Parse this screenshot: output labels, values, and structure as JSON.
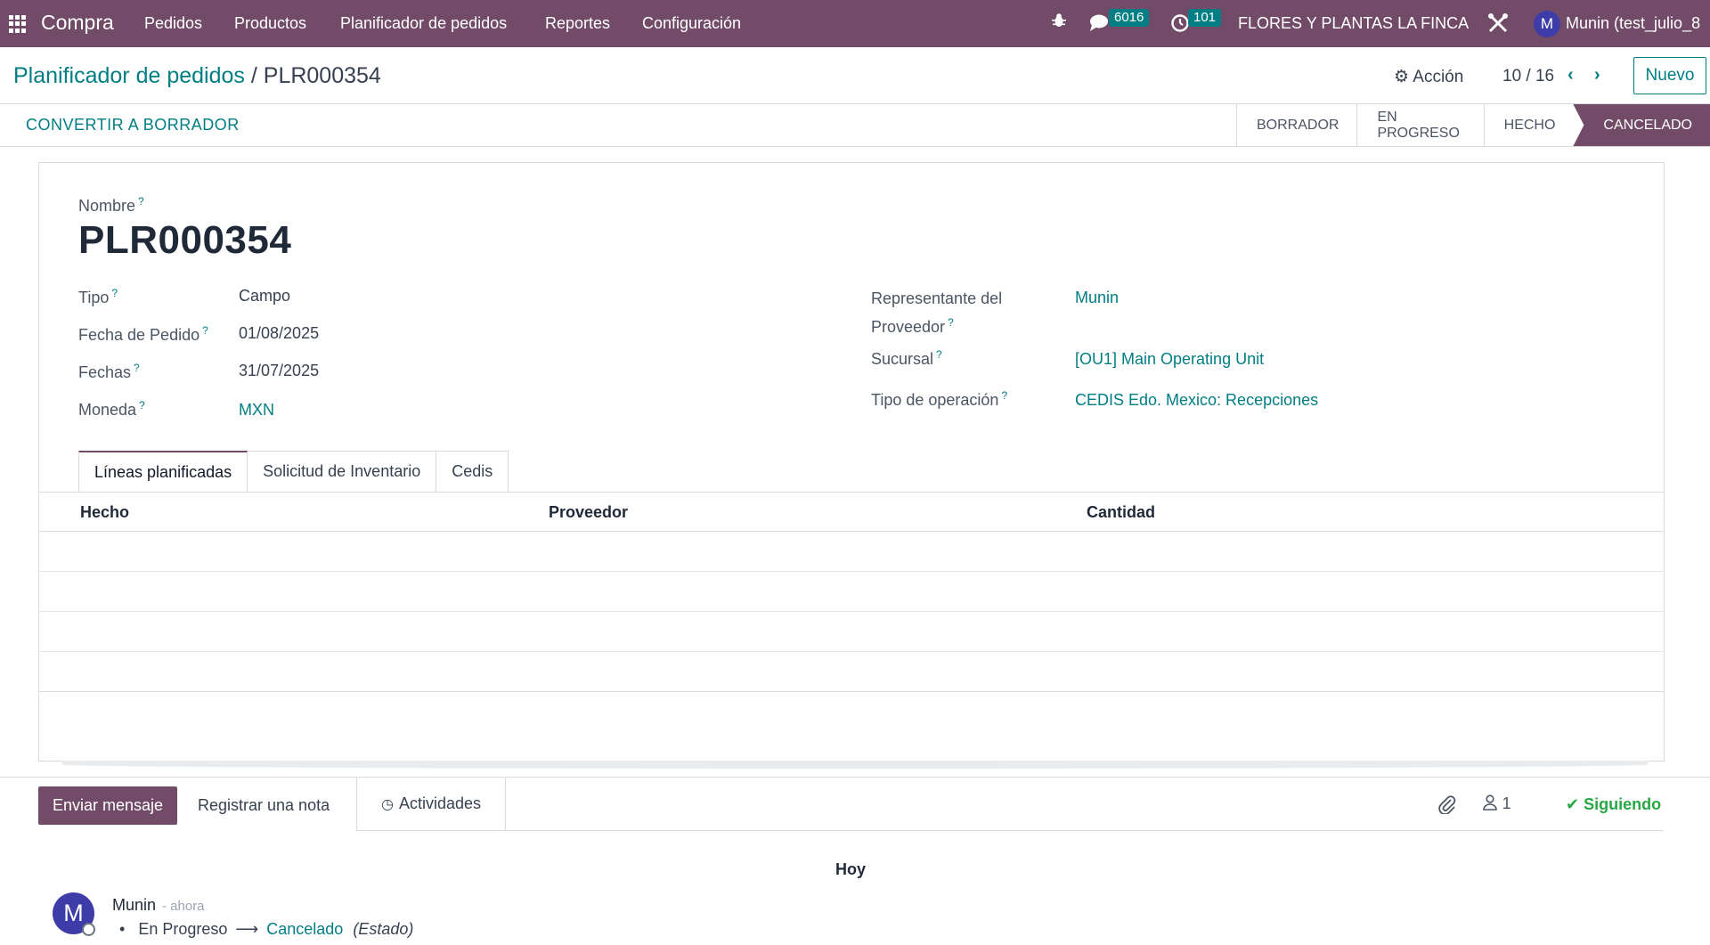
{
  "navbar": {
    "app_name": "Compra",
    "menu": [
      "Pedidos",
      "Productos",
      "Planificador de pedidos",
      "Reportes",
      "Configuración"
    ],
    "messages_count": "6016",
    "activities_count": "101",
    "company": "FLORES Y PLANTAS LA FINCA",
    "user_initial": "M",
    "user_name": "Munin (test_julio_8"
  },
  "control": {
    "breadcrumb_parent": "Planificador de pedidos",
    "breadcrumb_sep": "/",
    "breadcrumb_current": "PLR000354",
    "action_label": "Acción",
    "pager": "10 / 16",
    "new_label": "Nuevo"
  },
  "statusbar": {
    "convert_label": "CONVERTIR A BORRADOR",
    "stages": [
      "BORRADOR",
      "EN PROGRESO",
      "HECHO",
      "CANCELADO"
    ],
    "active_stage": "CANCELADO"
  },
  "form": {
    "name_label": "Nombre",
    "name_value": "PLR000354",
    "tipo_label": "Tipo",
    "tipo_value": "Campo",
    "fecha_pedido_label": "Fecha de Pedido",
    "fecha_pedido_value": "01/08/2025",
    "fechas_label": "Fechas",
    "fechas_value": "31/07/2025",
    "moneda_label": "Moneda",
    "moneda_value": "MXN",
    "rep_label_1": "Representante del",
    "rep_label_2": "Proveedor",
    "rep_value": "Munin",
    "sucursal_label": "Sucursal",
    "sucursal_value": "[OU1] Main Operating Unit",
    "tipo_op_label": "Tipo de operación",
    "tipo_op_value": "CEDIS Edo. Mexico: Recepciones",
    "help_mark": "?"
  },
  "tabs": [
    "Líneas planificadas",
    "Solicitud de Inventario",
    "Cedis"
  ],
  "table": {
    "columns": [
      "Hecho",
      "Proveedor",
      "Cantidad"
    ]
  },
  "chatter": {
    "send_label": "Enviar mensaje",
    "note_label": "Registrar una nota",
    "activities_label": "Actividades",
    "followers_count": "1",
    "following_label": "Siguiendo",
    "day_label": "Hoy",
    "message": {
      "author_initial": "M",
      "author": "Munin",
      "time": "- ahora",
      "old_value": "En Progreso",
      "arrow": "⟶",
      "new_value": "Cancelado",
      "field": "(Estado)"
    }
  },
  "colors": {
    "brand": "#714b67",
    "link": "#017e84",
    "success": "#28a745"
  }
}
